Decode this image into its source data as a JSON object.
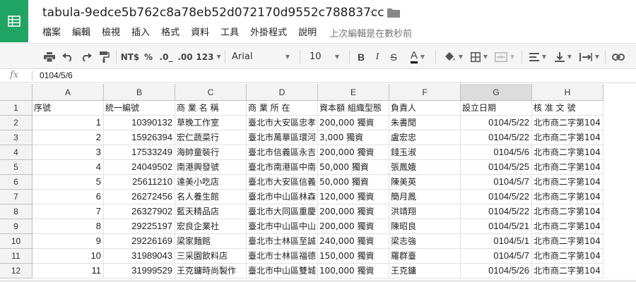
{
  "app": {
    "doc_title": "tabula-9edce5b762c8a78eb52d072170d9552c788837cc",
    "star_icon": "☆",
    "last_edit": "上次編輯是在數秒前"
  },
  "menu": [
    "檔案",
    "編輯",
    "檢視",
    "插入",
    "格式",
    "資料",
    "工具",
    "外掛程式",
    "說明"
  ],
  "toolbar": {
    "currency": "NT$",
    "percent": "%",
    "dec_decrease": ".0_",
    "dec_increase": ".00",
    "more_formats": "123",
    "font": "Arial",
    "font_size": "10",
    "bold": "B",
    "italic": "I",
    "strike": "S",
    "text_color": "A"
  },
  "formula": {
    "fx": "fx",
    "value": "0104/5/6"
  },
  "grid": {
    "columns": [
      "A",
      "B",
      "C",
      "D",
      "E",
      "F",
      "G",
      "H"
    ],
    "selected_column": "G",
    "row_numbers": [
      "1",
      "2",
      "3",
      "4",
      "5",
      "6",
      "7",
      "8",
      "9",
      "10",
      "11",
      "12"
    ],
    "rows": [
      [
        "序號",
        "統一編號",
        "商 業 名 稱",
        "商 業 所 在",
        "資本額 組織型態",
        "負責人",
        "設立日期",
        "核 准 文 號"
      ],
      [
        "1",
        "10390132",
        "草晚工作室",
        "臺北市大安區忠孝",
        "200,000 獨資",
        "朱書閒",
        "0104/5/22",
        "北市商二字第104"
      ],
      [
        "2",
        "15926394",
        "宏仁蔬菜行",
        "臺北市萬華區環河",
        "3,000 獨資",
        "盧宏忠",
        "0104/5/22",
        "北市商二字第104"
      ],
      [
        "3",
        "17533249",
        "海帥童裝行",
        "臺北市信義區永吉",
        "200,000 獨資",
        "錢玉淑",
        "0104/5/6",
        "北市商二字第104"
      ],
      [
        "4",
        "24049502",
        "南港興發號",
        "臺北市南港區中南",
        "50,000 獨資",
        "張鳳娥",
        "0104/5/25",
        "北市商二字第104"
      ],
      [
        "5",
        "25611210",
        "達美小吃店",
        "臺北市大安區信義",
        "50,000 獨資",
        "陳美英",
        "0104/5/7",
        "北市商二字第104"
      ],
      [
        "6",
        "26272456",
        "名人養生館",
        "臺北市中山區林森",
        "120,000 獨資",
        "簡月鳳",
        "0104/5/22",
        "北市商二字第104"
      ],
      [
        "7",
        "26327902",
        "藍天精品店",
        "臺北市大同區重慶",
        "200,000 獨資",
        "洪靖翔",
        "0104/5/22",
        "北市商二字第104"
      ],
      [
        "8",
        "29225197",
        "宏良企業社",
        "臺北市中山區中山",
        "200,000 獨資",
        "陳昭良",
        "0104/5/21",
        "北市商二字第104"
      ],
      [
        "9",
        "29226169",
        "梁家麵館",
        "臺北市士林區至誠",
        "240,000 獨資",
        "梁志強",
        "0104/5/1",
        "北市商二字第104"
      ],
      [
        "10",
        "31989043",
        "三采園飲料店",
        "臺北市士林區福德",
        "150,000 獨資",
        "羅群臺",
        "0104/5/7",
        "北市商二字第104"
      ],
      [
        "11",
        "31999529",
        "王克鏞時尚製作",
        "臺北市中山區雙城",
        "100,000 獨資",
        "王克鏞",
        "0104/5/26",
        "北市商二字第104"
      ]
    ]
  },
  "colors": {
    "brand": "#1fa463",
    "header_bg": "#f3f3f3",
    "selected_header": "#dcdcdc",
    "text_color_underline": "#000000"
  }
}
